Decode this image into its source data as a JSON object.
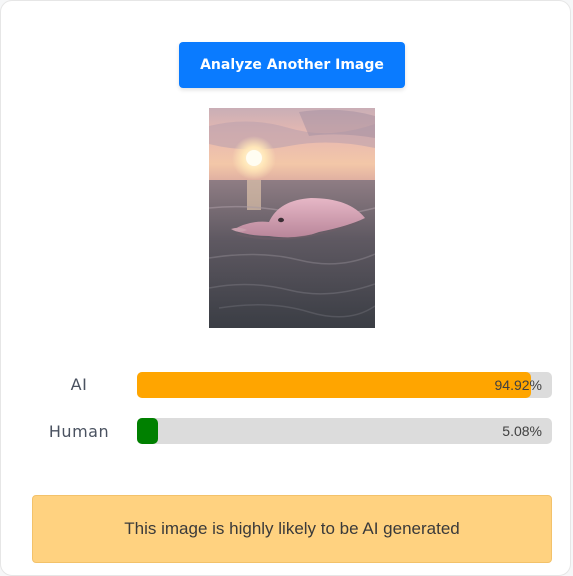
{
  "actions": {
    "analyze_label": "Analyze Another Image"
  },
  "preview": {
    "subject": "pink dolphin in sea at sunset"
  },
  "results": [
    {
      "label": "AI",
      "value_text": "94.92%",
      "fraction": 0.9492,
      "color": "#ffa500"
    },
    {
      "label": "Human",
      "value_text": "5.08%",
      "fraction": 0.0508,
      "color": "#008000"
    }
  ],
  "verdict": {
    "text": "This image is highly likely to be AI generated",
    "background": "#ffd280"
  },
  "theme": {
    "primary": "#0a7bff",
    "track": "#dcdcdc"
  }
}
